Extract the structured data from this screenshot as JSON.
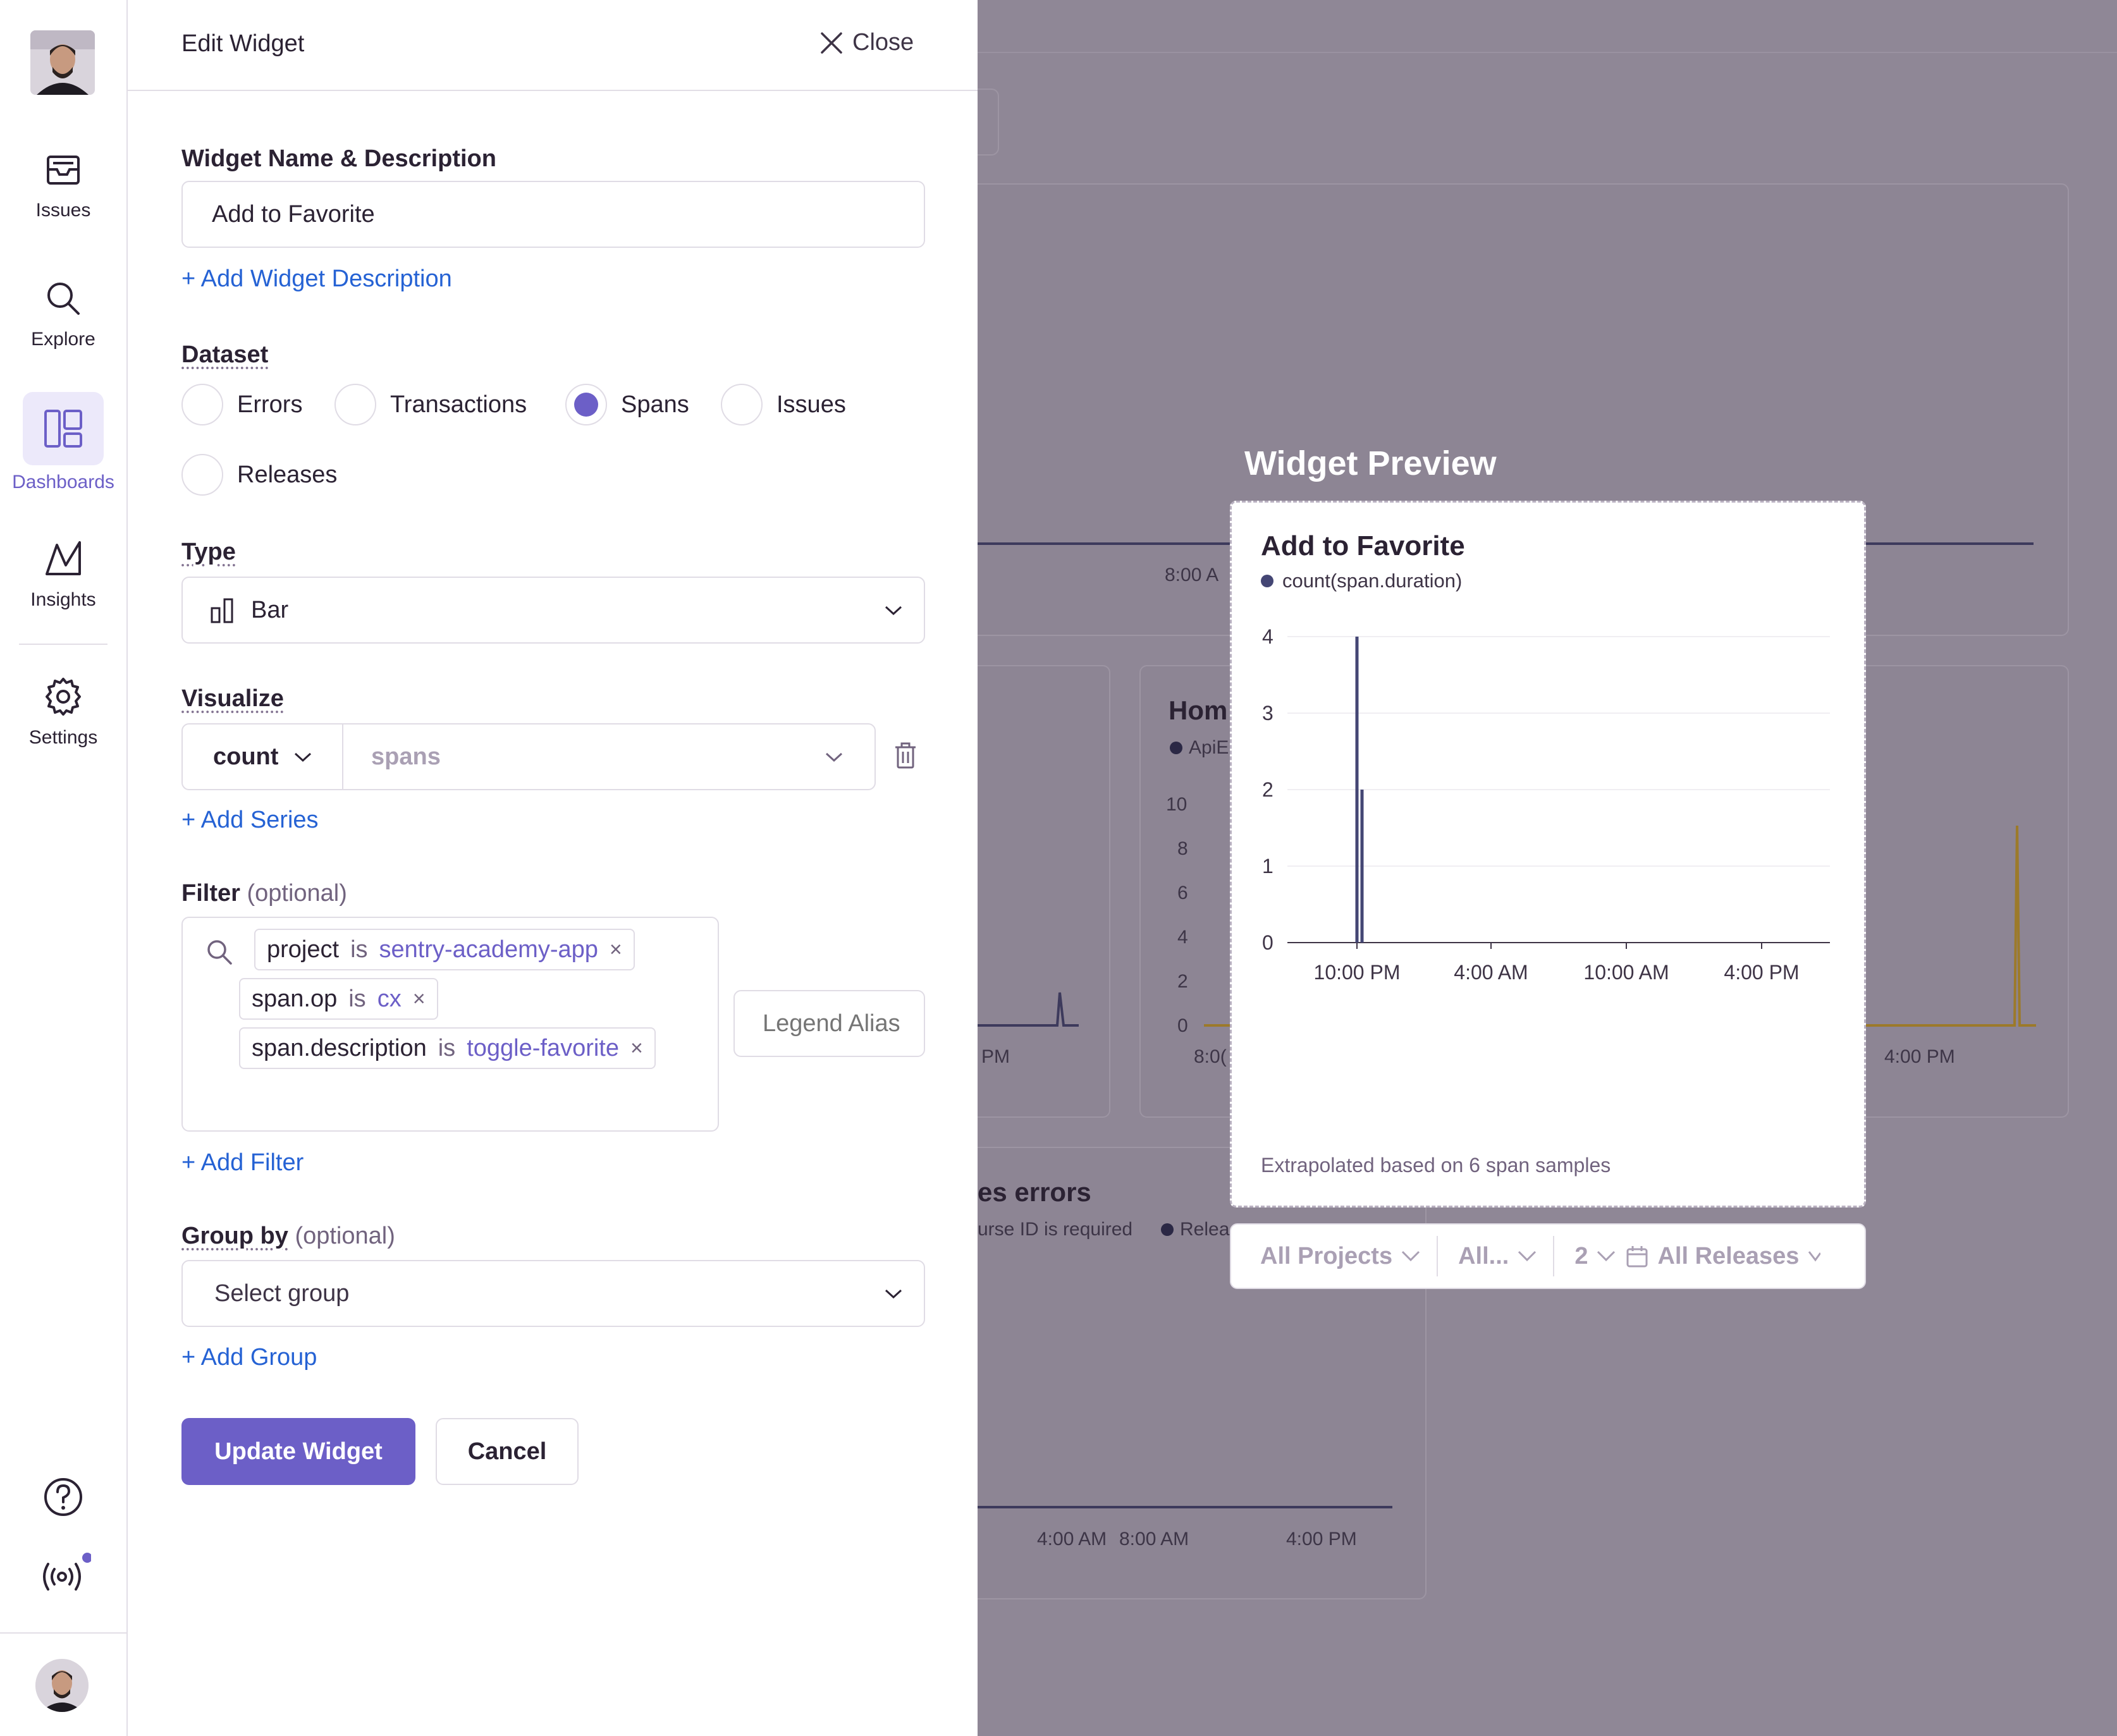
{
  "nav": {
    "items": [
      {
        "label": "Issues",
        "icon": "inbox-icon"
      },
      {
        "label": "Explore",
        "icon": "search-icon"
      },
      {
        "label": "Dashboards",
        "icon": "dashboard-icon"
      },
      {
        "label": "Insights",
        "icon": "insights-icon"
      },
      {
        "label": "Settings",
        "icon": "gear-icon"
      }
    ],
    "active": "Dashboards",
    "bottom_icons": [
      "help-icon",
      "broadcast-icon"
    ]
  },
  "background": {
    "tick_800a": "8:00 A",
    "card2_title": "Hom",
    "card2_legend": "ApiE",
    "card2_y": [
      "10",
      "8",
      "6",
      "4",
      "2",
      "0"
    ],
    "card2_x": "8:0(",
    "pm_label": "PM",
    "right_tick": "4:00 PM",
    "errors_title": "es errors",
    "errors_legend": "urse ID is required",
    "errors_legend2": "Relea",
    "bottom_ticks": [
      "4:00 AM",
      "8:00 AM",
      "4:00 PM"
    ]
  },
  "panel": {
    "title": "Edit Widget",
    "close_label": "Close",
    "name_label": "Widget Name & Description",
    "name_value": "Add to Favorite",
    "add_description": "+ Add Widget Description",
    "dataset_label": "Dataset",
    "datasets": [
      "Errors",
      "Transactions",
      "Spans",
      "Issues",
      "Releases"
    ],
    "dataset_selected": "Spans",
    "type_label": "Type",
    "type_value": "Bar",
    "visualize_label": "Visualize",
    "aggregate": "count",
    "field_placeholder": "spans",
    "add_series": "+ Add Series",
    "filter_label": "Filter",
    "optional": "(optional)",
    "filters": [
      {
        "key": "project",
        "op": "is",
        "value": "sentry-academy-app"
      },
      {
        "key": "span.op",
        "op": "is",
        "value": "cx"
      },
      {
        "key": "span.description",
        "op": "is",
        "value": "toggle-favorite"
      }
    ],
    "legend_alias_placeholder": "Legend Alias",
    "add_filter": "+ Add Filter",
    "groupby_label": "Group by",
    "group_placeholder": "Select group",
    "add_group": "+ Add Group",
    "update_button": "Update Widget",
    "cancel_button": "Cancel"
  },
  "preview": {
    "heading": "Widget Preview",
    "footer": "Extrapolated based on 6 span samples",
    "page_filters": {
      "projects": "All Projects",
      "environments": "All...",
      "period": "2",
      "releases": "All Releases"
    }
  },
  "chart_data": {
    "type": "bar",
    "title": "Add to Favorite",
    "series": [
      {
        "name": "count(span.duration)",
        "color": "#444674",
        "points": [
          {
            "x": "~9:57 PM",
            "y": 4
          },
          {
            "x": "~10:03 PM",
            "y": 2
          }
        ]
      }
    ],
    "x_ticks": [
      "10:00 PM",
      "4:00 AM",
      "10:00 AM",
      "4:00 PM"
    ],
    "y_ticks": [
      "0",
      "1",
      "2",
      "3",
      "4"
    ],
    "ylim": [
      0,
      4
    ],
    "grid": true
  },
  "colors": {
    "accent": "#6c5fc7",
    "link": "#2562d4",
    "series": "#444674",
    "overlay": "#8f8796"
  }
}
